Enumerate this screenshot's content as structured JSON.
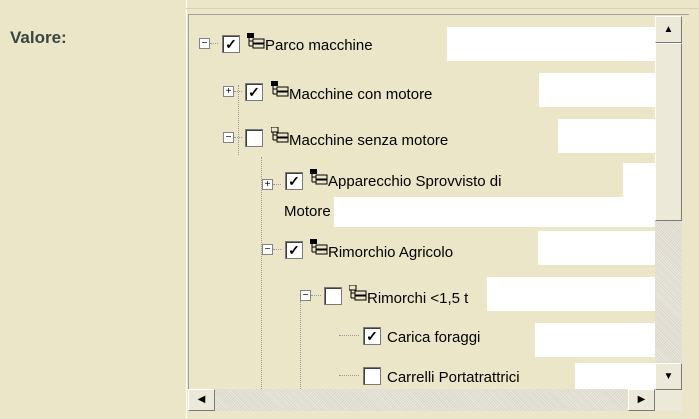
{
  "field_label": "Valore:",
  "tree": {
    "nodes": [
      {
        "label": "Parco macchine",
        "expander": "−",
        "checked": true
      },
      {
        "label": "Macchine con motore",
        "expander": "+",
        "checked": true
      },
      {
        "label": "Macchine senza motore",
        "expander": "−",
        "checked": false
      },
      {
        "label": "Apparecchio Sprovvisto di",
        "label2": "Motore",
        "expander": "+",
        "checked": true
      },
      {
        "label": "Rimorchio Agricolo",
        "expander": "−",
        "checked": true
      },
      {
        "label": "Rimorchi <1,5 t",
        "expander": "−",
        "checked": false
      },
      {
        "label": "Carica foraggi",
        "checked": true
      },
      {
        "label": "Carrelli Portatrattrici",
        "checked": false
      }
    ]
  },
  "scrollbar": {
    "up_arrow": "▲",
    "down_arrow": "▼",
    "left_arrow": "◀",
    "right_arrow": "▶"
  }
}
